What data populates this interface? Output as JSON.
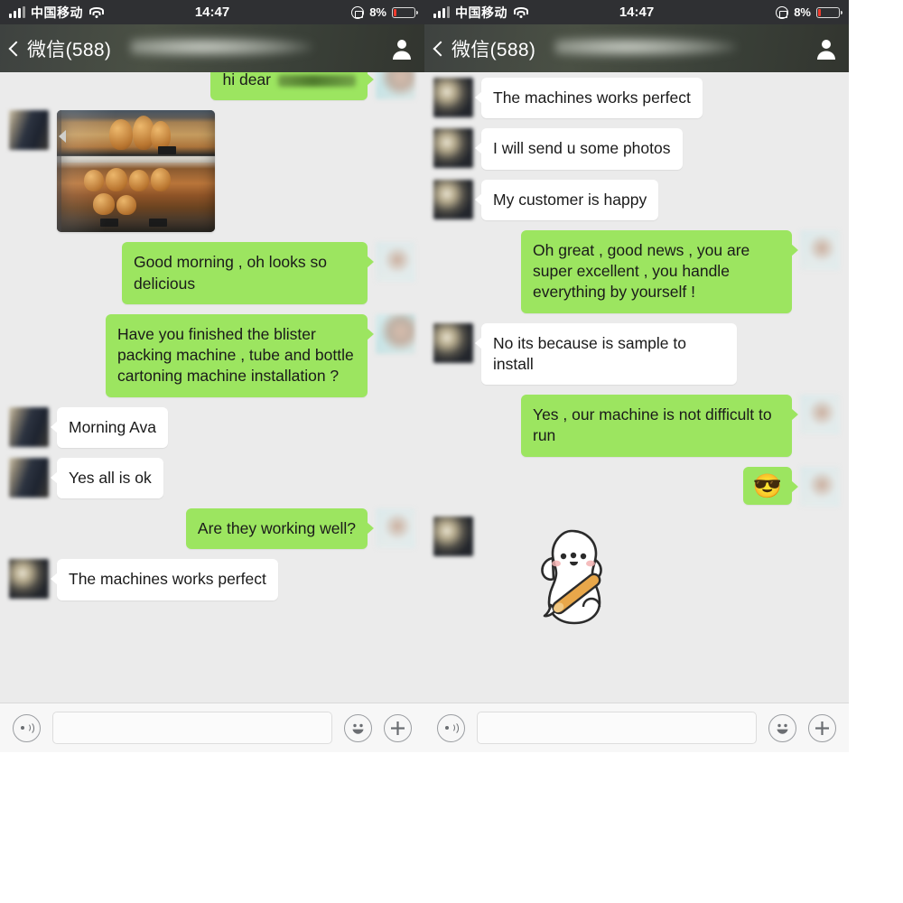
{
  "app": {
    "name": "WeChat",
    "platform": "iOS"
  },
  "statusbar": {
    "carrier": "中国移动",
    "signal_icon": "signal-bars-icon",
    "wifi_icon": "wifi-icon",
    "time": "14:47",
    "rotation_lock_icon": "rotation-lock-icon",
    "battery_percent": "8%",
    "battery_icon": "battery-low-icon"
  },
  "navbar": {
    "back_icon": "chevron-left-icon",
    "back_label": "微信(588)",
    "contact_name_redacted": "",
    "profile_icon": "contact-profile-icon"
  },
  "colors": {
    "outgoing_bubble": "#9ce560",
    "incoming_bubble": "#ffffff",
    "chat_background": "#ebebeb",
    "statusbar_background": "#2f3033",
    "battery_low": "#f03b2d",
    "input_background": "#f7f7f7"
  },
  "left_panel": {
    "messages": [
      {
        "id": "l1",
        "side": "out",
        "type": "text",
        "text": "hi dear",
        "has_redaction": true
      },
      {
        "id": "l2",
        "side": "in",
        "type": "image",
        "alt": "bakery display case with pastries"
      },
      {
        "id": "l3",
        "side": "out",
        "type": "text",
        "text": "Good morning , oh looks so delicious"
      },
      {
        "id": "l4",
        "side": "out",
        "type": "text",
        "text": "Have you finished the blister packing machine , tube and bottle cartoning machine installation ?"
      },
      {
        "id": "l5",
        "side": "in",
        "type": "text",
        "text": "Morning Ava"
      },
      {
        "id": "l6",
        "side": "in",
        "type": "text",
        "text": "Yes all is ok"
      },
      {
        "id": "l7",
        "side": "out",
        "type": "text",
        "text": "Are they working well?"
      },
      {
        "id": "l8",
        "side": "in",
        "type": "text",
        "text": "The machines works perfect"
      }
    ]
  },
  "right_panel": {
    "messages": [
      {
        "id": "r1",
        "side": "in",
        "type": "text",
        "text": "The machines works perfect"
      },
      {
        "id": "r2",
        "side": "in",
        "type": "text",
        "text": "I will send u some photos"
      },
      {
        "id": "r3",
        "side": "in",
        "type": "text",
        "text": "My customer is happy"
      },
      {
        "id": "r4",
        "side": "out",
        "type": "text",
        "text": "Oh great , good news , you are super excellent , you handle everything by yourself !"
      },
      {
        "id": "r5",
        "side": "in",
        "type": "text",
        "text": "No its because is sample to install"
      },
      {
        "id": "r6",
        "side": "out",
        "type": "text",
        "text": "Yes , our machine is not difficult to run"
      },
      {
        "id": "r7",
        "side": "out",
        "type": "emoji",
        "text": "😎"
      },
      {
        "id": "r8",
        "side": "in",
        "type": "sticker",
        "alt": "white cartoon dog holding an orange baseball bat"
      }
    ]
  },
  "inputbar": {
    "voice_icon": "voice-message-icon",
    "field_value": "",
    "field_placeholder": "",
    "emoji_icon": "smiley-face-icon",
    "more_icon": "plus-circle-icon"
  }
}
